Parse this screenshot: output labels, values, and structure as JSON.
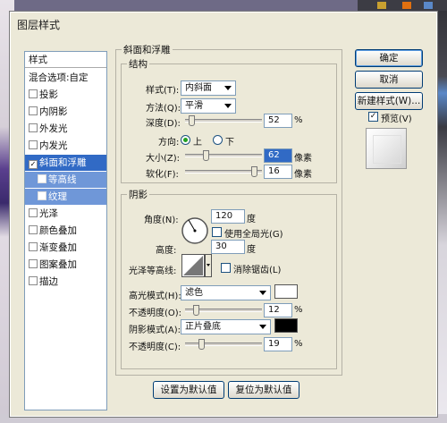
{
  "window": {
    "title": "图层样式"
  },
  "styles_list": {
    "header": "样式",
    "items": [
      {
        "label": "混合选项:自定",
        "checkbox": false
      },
      {
        "label": "投影",
        "checkbox": true,
        "checked": false
      },
      {
        "label": "内阴影",
        "checkbox": true,
        "checked": false
      },
      {
        "label": "外发光",
        "checkbox": true,
        "checked": false
      },
      {
        "label": "内发光",
        "checkbox": true,
        "checked": false
      },
      {
        "label": "斜面和浮雕",
        "checkbox": true,
        "checked": true,
        "selected": true
      },
      {
        "label": "等高线",
        "checkbox": true,
        "checked": false,
        "sub": true
      },
      {
        "label": "纹理",
        "checkbox": true,
        "checked": false,
        "sub": true
      },
      {
        "label": "光泽",
        "checkbox": true,
        "checked": false
      },
      {
        "label": "颜色叠加",
        "checkbox": true,
        "checked": false
      },
      {
        "label": "渐变叠加",
        "checkbox": true,
        "checked": false
      },
      {
        "label": "图案叠加",
        "checkbox": true,
        "checked": false
      },
      {
        "label": "描边",
        "checkbox": true,
        "checked": false
      }
    ]
  },
  "bevel": {
    "section_title": "斜面和浮雕",
    "structure": {
      "title": "结构",
      "style_label": "样式(T):",
      "style_value": "内斜面",
      "technique_label": "方法(Q):",
      "technique_value": "平滑",
      "depth_label": "深度(D):",
      "depth_value": "52",
      "depth_unit": "%",
      "depth_level": 0.052,
      "direction_label": "方向:",
      "direction_up": "上",
      "direction_down": "下",
      "size_label": "大小(Z):",
      "size_value": "62",
      "size_unit": "像素",
      "size_level": 0.25,
      "soften_label": "软化(F):",
      "soften_value": "16",
      "soften_unit": "像素",
      "soften_level": 0.94
    },
    "shading": {
      "title": "阴影",
      "angle_label": "角度(N):",
      "angle_value": "120",
      "angle_unit": "度",
      "global_light_label": "使用全局光(G)",
      "altitude_label": "高度:",
      "altitude_value": "30",
      "altitude_unit": "度",
      "gloss_label": "光泽等高线:",
      "antialias_label": "消除锯齿(L)",
      "highlight_label": "高光模式(H):",
      "highlight_mode": "滤色",
      "highlight_color": "#ffffff",
      "hl_opacity_label": "不透明度(O):",
      "hl_opacity_value": "12",
      "hl_opacity_unit": "%",
      "hl_opacity_level": 0.12,
      "shadow_label": "阴影模式(A):",
      "shadow_mode": "正片叠底",
      "shadow_color": "#000000",
      "sh_opacity_label": "不透明度(C):",
      "sh_opacity_value": "19",
      "sh_opacity_unit": "%",
      "sh_opacity_level": 0.19
    },
    "make_default": "设置为默认值",
    "reset_default": "复位为默认值"
  },
  "buttons": {
    "ok": "确定",
    "cancel": "取消",
    "new_style": "新建样式(W)...",
    "preview_label": "预览(V)"
  }
}
